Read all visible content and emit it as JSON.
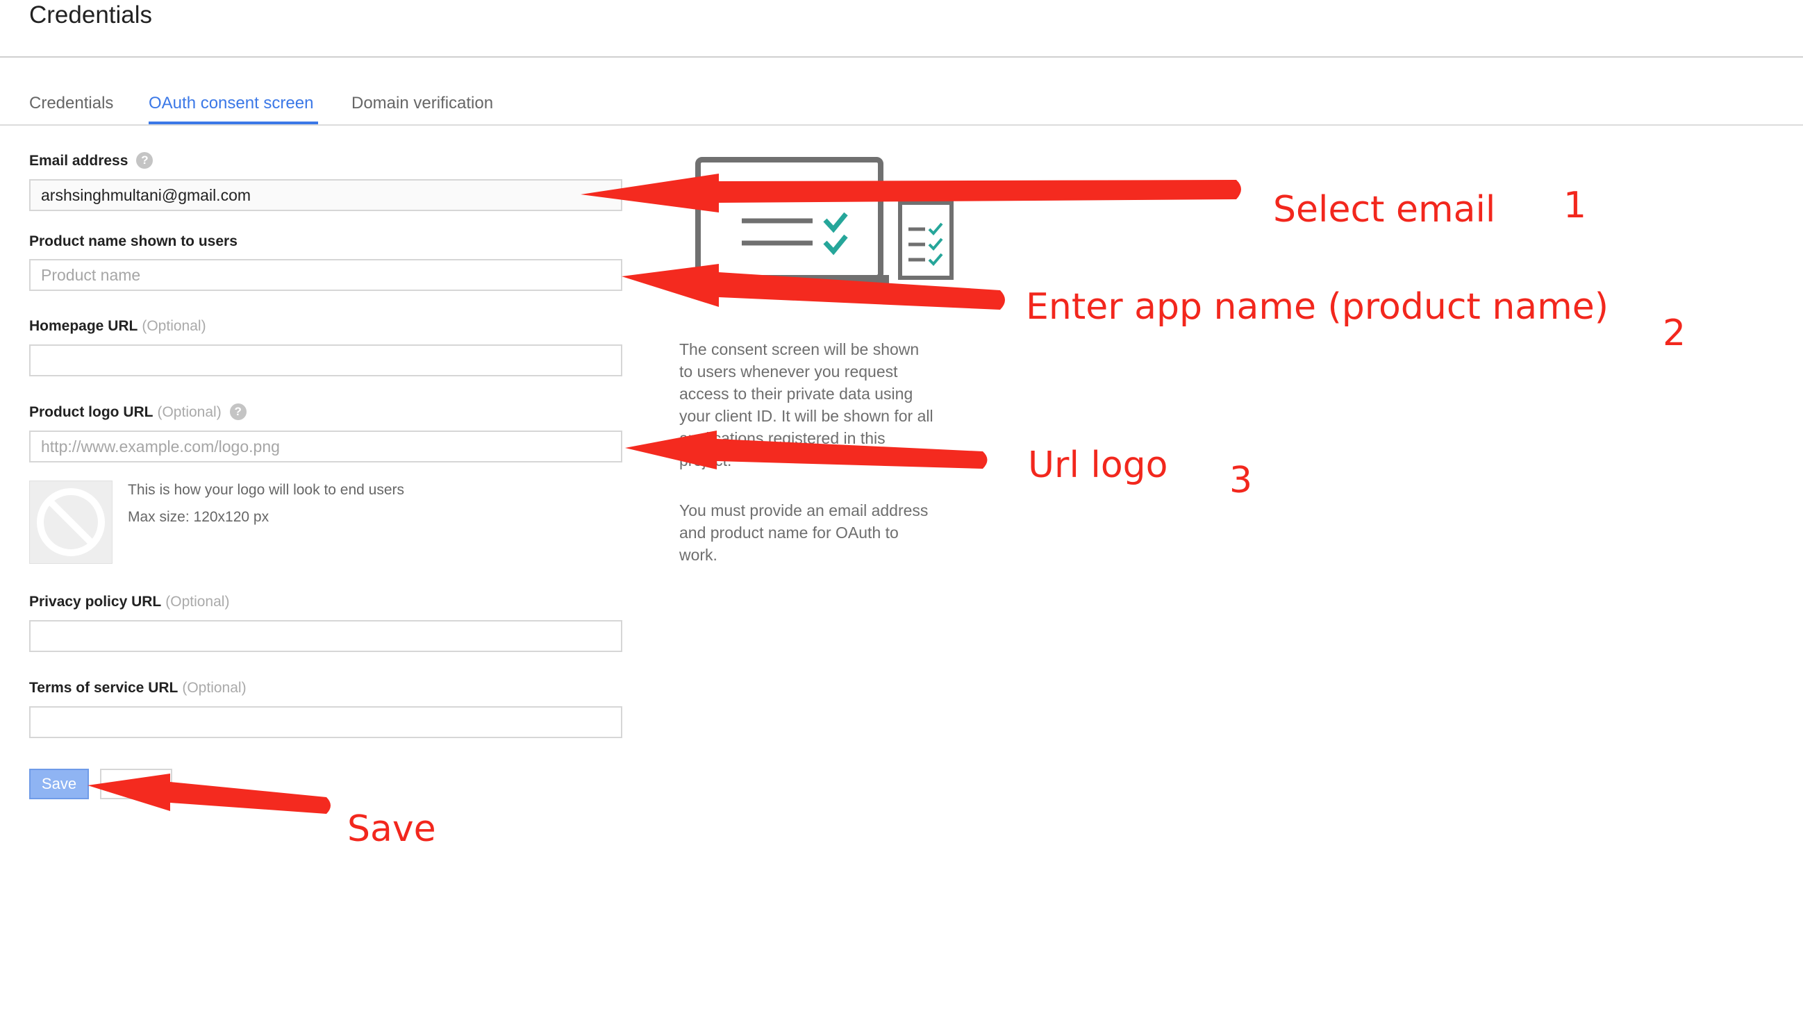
{
  "header": {
    "title": "Credentials"
  },
  "tabs": [
    {
      "label": "Credentials",
      "active": false
    },
    {
      "label": "OAuth consent screen",
      "active": true
    },
    {
      "label": "Domain verification",
      "active": false
    }
  ],
  "form": {
    "email": {
      "label": "Email address",
      "value": "arshsinghmultani@gmail.com"
    },
    "product_name": {
      "label": "Product name shown to users",
      "placeholder": "Product name"
    },
    "homepage": {
      "label": "Homepage URL",
      "optional": "(Optional)",
      "value": ""
    },
    "logo": {
      "label": "Product logo URL",
      "optional": "(Optional)",
      "placeholder": "http://www.example.com/logo.png",
      "note1": "This is how your logo will look to end users",
      "note2": "Max size: 120x120 px"
    },
    "privacy": {
      "label": "Privacy policy URL",
      "optional": "(Optional)",
      "value": ""
    },
    "tos": {
      "label": "Terms of service URL",
      "optional": "(Optional)",
      "value": ""
    },
    "save_label": "Save",
    "cancel_label": ""
  },
  "info": {
    "line1": "The consent screen will be shown",
    "line2": "to users whenever you request",
    "line3": "access to their private data using",
    "line4": "your client ID. It will be shown for all",
    "line5": "applications registered in this",
    "line6": "project.",
    "p2_line1": "You must provide an email address",
    "p2_line2": "and product name for OAuth to",
    "p2_line3": "work."
  },
  "annotations": {
    "a1": {
      "text": "Select email",
      "num": "1"
    },
    "a2": {
      "text": "Enter app name (product name)",
      "num": "2"
    },
    "a3": {
      "text": "Url logo",
      "num": "3"
    },
    "a4": {
      "text": "Save"
    }
  },
  "colors": {
    "accent": "#3b78e7",
    "annotation": "#f2271d",
    "check": "#26a69a"
  },
  "icons": {
    "help": "help-circle-icon",
    "caret": "dropdown-caret-icon",
    "logo_placeholder": "no-image-icon",
    "illustration": "consent-screen-illustration"
  }
}
